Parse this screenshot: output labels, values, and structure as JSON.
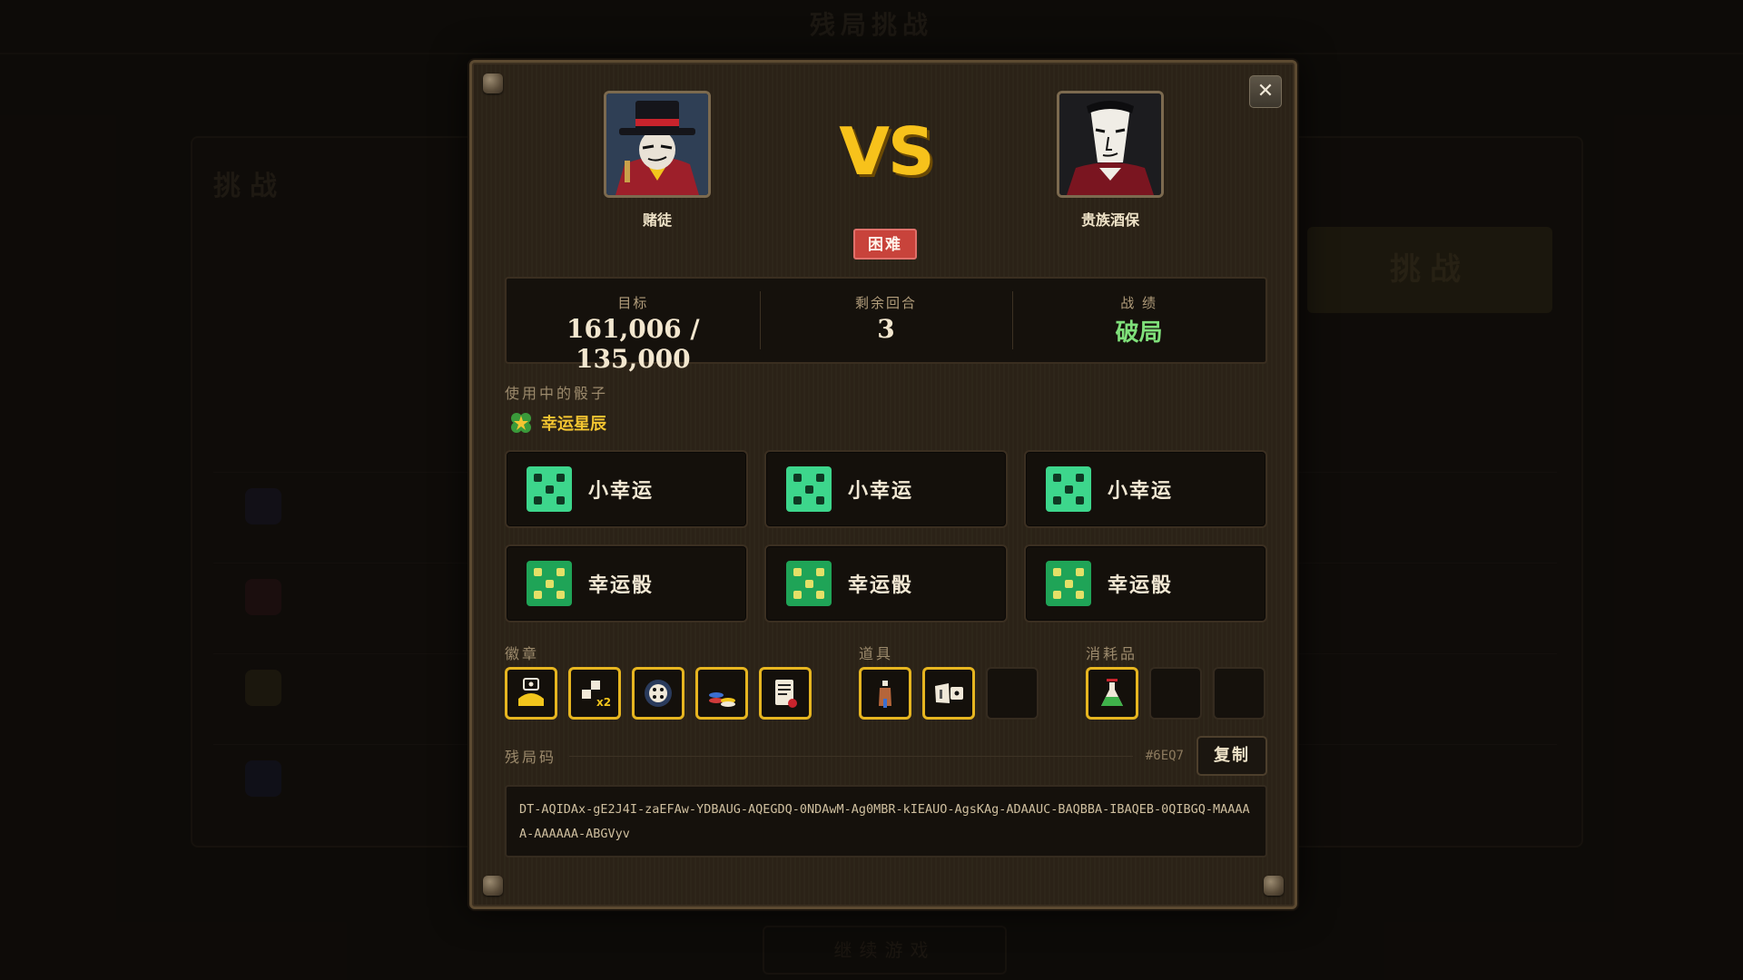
{
  "modal": {
    "player_left": {
      "name": "赌徒"
    },
    "player_right": {
      "name": "贵族酒保"
    },
    "vs_text": "VS",
    "difficulty": "困难",
    "close_icon": "close-icon"
  },
  "stats": {
    "target_label": "目标",
    "target_value": "161,006 / 135,000",
    "rounds_label": "剩余回合",
    "rounds_value": "3",
    "record_label": "战 绩",
    "record_value": "破局"
  },
  "dice_section": {
    "label": "使用中的骰子",
    "set_icon": "clover-star-icon",
    "set_name": "幸运星辰",
    "dice": [
      {
        "name": "小幸运",
        "style": "light",
        "pips": 5
      },
      {
        "name": "小幸运",
        "style": "light",
        "pips": 5
      },
      {
        "name": "小幸运",
        "style": "light",
        "pips": 5
      },
      {
        "name": "幸运骰",
        "style": "dark",
        "pips": 5
      },
      {
        "name": "幸运骰",
        "style": "dark",
        "pips": 5
      },
      {
        "name": "幸运骰",
        "style": "dark",
        "pips": 5
      }
    ]
  },
  "badges": {
    "label": "徽章",
    "items": [
      "money-bag-icon",
      "dice-x2-icon",
      "dice-gear-icon",
      "coin-stack-icon",
      "scroll-document-icon"
    ]
  },
  "items": {
    "label": "道具",
    "slots": [
      "potion-bottle-icon",
      "ticket-dice-icon",
      null
    ]
  },
  "consumables": {
    "label": "消耗品",
    "slots": [
      "flask-icon",
      null,
      null
    ]
  },
  "save_code": {
    "label": "残局码",
    "id": "#6EQ7",
    "copy_label": "复制",
    "code": "DT-AQIDAx-gE2J4I-zaEFAw-YDBAUG-AQEGDQ-0NDAwM-Ag0MBR-kIEAUO-AgsKAg-ADAAUC-BAQBBA-IBAQEB-0QIBGQ-MAAAAA-AAAAAA-ABGVyv"
  },
  "background": {
    "bottom_button": "继续游戏",
    "side_button": "挑战"
  }
}
